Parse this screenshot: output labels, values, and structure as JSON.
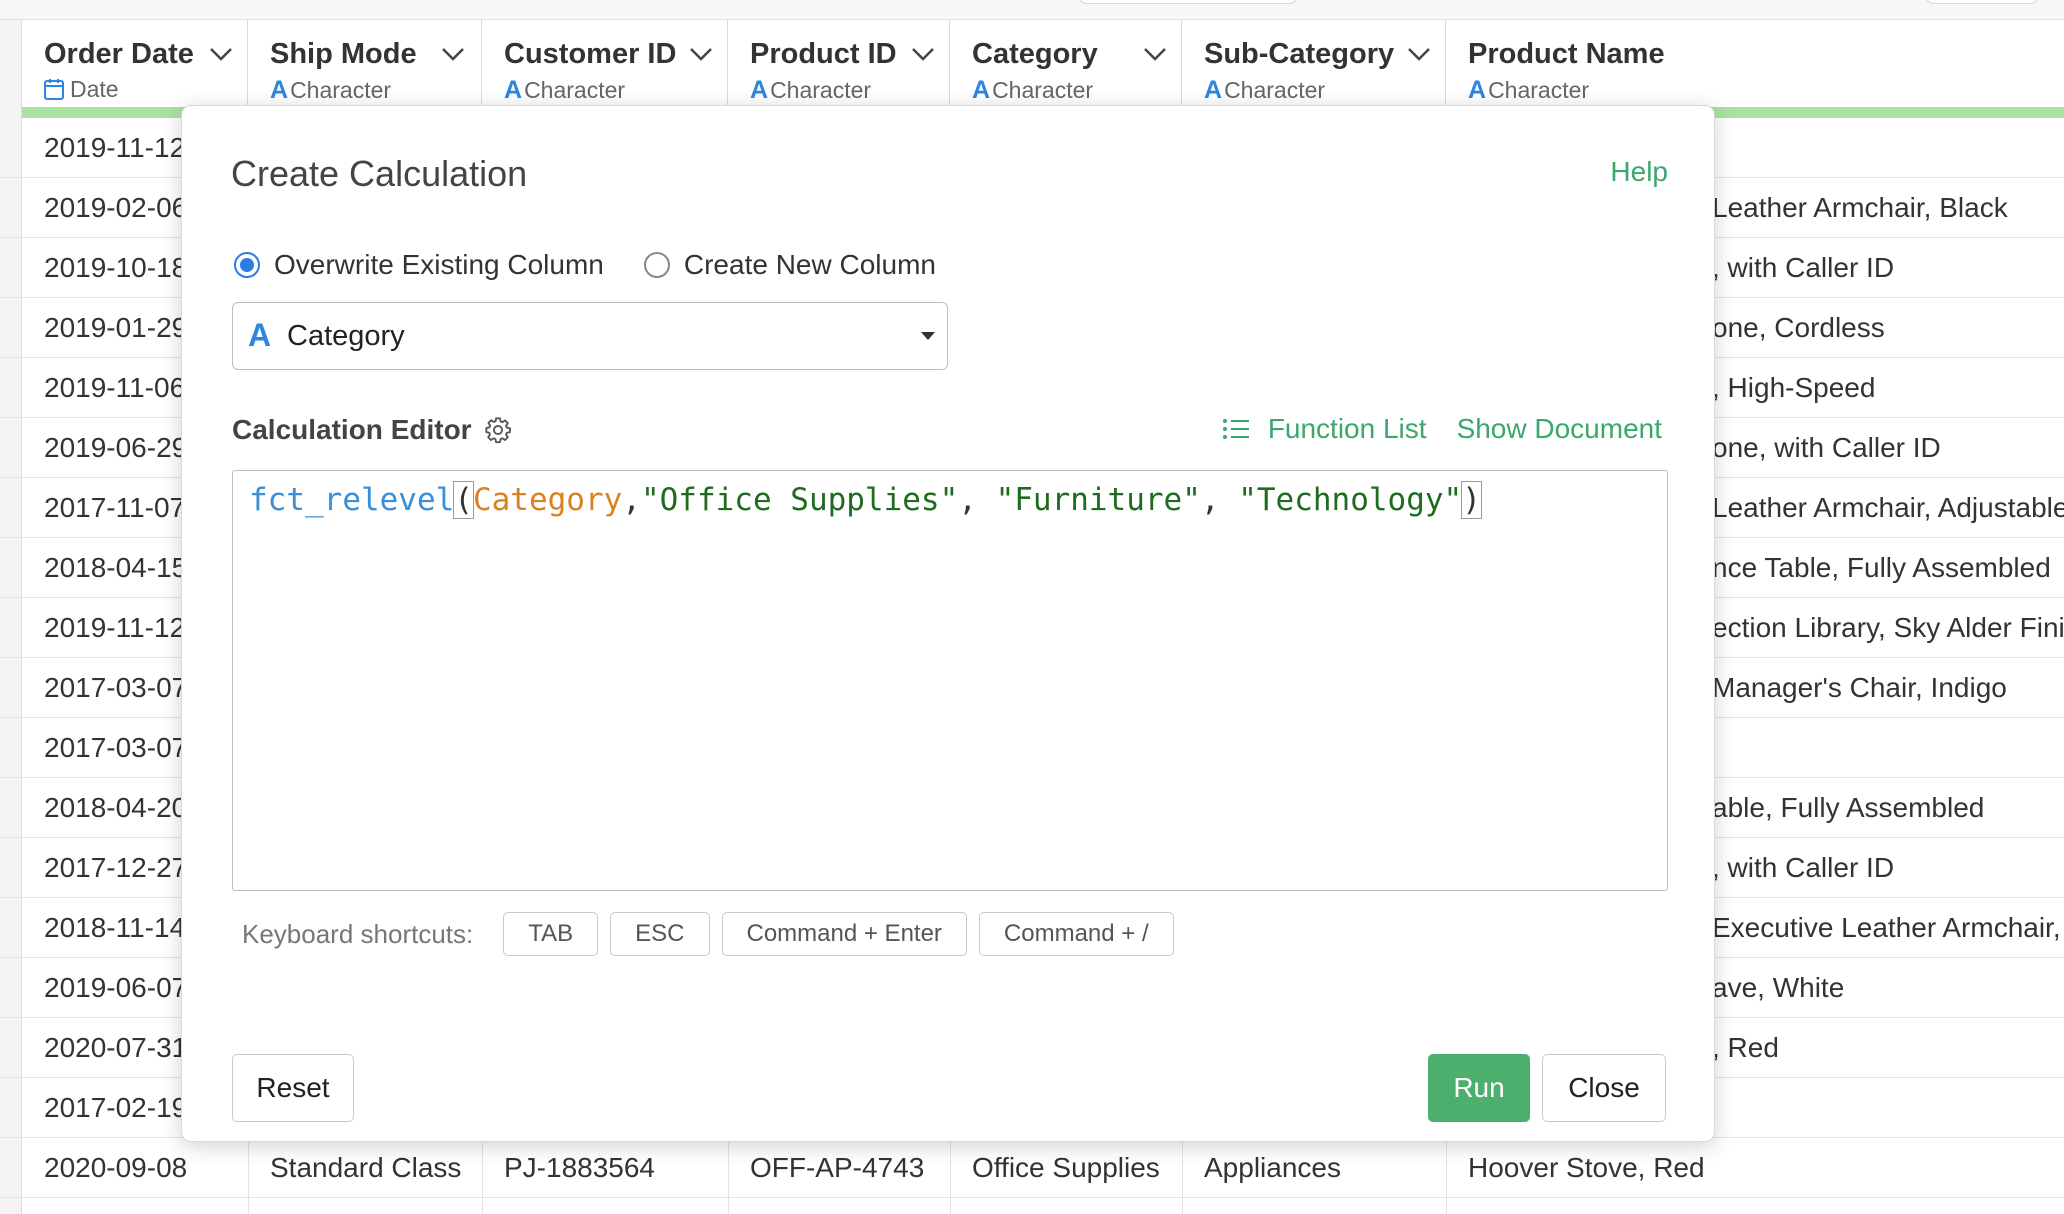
{
  "columns": [
    {
      "name": "Order Date",
      "type": "Date",
      "type_icon": "calendar-icon"
    },
    {
      "name": "Ship Mode",
      "type": "Character",
      "type_icon": "character-type-icon"
    },
    {
      "name": "Customer ID",
      "type": "Character",
      "type_icon": "character-type-icon"
    },
    {
      "name": "Product ID",
      "type": "Character",
      "type_icon": "character-type-icon"
    },
    {
      "name": "Category",
      "type": "Character",
      "type_icon": "character-type-icon"
    },
    {
      "name": "Sub-Category",
      "type": "Character",
      "type_icon": "character-type-icon"
    },
    {
      "name": "Product Name",
      "type": "Character",
      "type_icon": "character-type-icon"
    }
  ],
  "type_letter": "A",
  "rows": [
    {
      "order_date": "2019-11-12",
      "product_name": ""
    },
    {
      "order_date": "2019-02-06",
      "product_name": "Leather Armchair, Black"
    },
    {
      "order_date": "2019-10-18",
      "product_name": ", with Caller ID"
    },
    {
      "order_date": "2019-01-29",
      "product_name": "one, Cordless"
    },
    {
      "order_date": "2019-11-06",
      "product_name": ", High-Speed"
    },
    {
      "order_date": "2019-06-29",
      "product_name": "one, with Caller ID"
    },
    {
      "order_date": "2017-11-07",
      "product_name": "Leather Armchair, Adjustable"
    },
    {
      "order_date": "2018-04-15",
      "product_name": "nce Table, Fully Assembled"
    },
    {
      "order_date": "2019-11-12",
      "product_name": "ection Library, Sky Alder Finish"
    },
    {
      "order_date": "2017-03-07",
      "product_name": "Manager's Chair, Indigo"
    },
    {
      "order_date": "2017-03-07",
      "product_name": ""
    },
    {
      "order_date": "2018-04-20",
      "product_name": "able, Fully Assembled"
    },
    {
      "order_date": "2017-12-27",
      "product_name": ", with Caller ID"
    },
    {
      "order_date": "2018-11-14",
      "product_name": "Executive Leather Armchair, A"
    },
    {
      "order_date": "2019-06-07",
      "product_name": "ave, White"
    },
    {
      "order_date": "2020-07-31",
      "product_name": ", Red"
    },
    {
      "order_date": "2017-02-19",
      "product_name": ""
    }
  ],
  "last_row": {
    "order_date": "2020-09-08",
    "ship_mode": "Standard Class",
    "customer_id": "PJ-1883564",
    "product_id": "OFF-AP-4743",
    "category": "Office Supplies",
    "sub_category": "Appliances",
    "product_name": "Hoover Stove, Red"
  },
  "dialog": {
    "title": "Create Calculation",
    "help": "Help",
    "radio_overwrite": "Overwrite Existing Column",
    "radio_new": "Create New Column",
    "selected_mode": "overwrite",
    "column_select": {
      "type_letter": "A",
      "value": "Category"
    },
    "editor_label": "Calculation Editor",
    "function_list": "Function List",
    "show_document": "Show Document",
    "code": {
      "fn": "fct_relevel",
      "open": "(",
      "col": "Category",
      "comma1": ",",
      "s1": "\"Office Supplies\"",
      "sep1": ", ",
      "s2": "\"Furniture\"",
      "sep2": ", ",
      "s3": "\"Technology\"",
      "close": ")"
    },
    "shortcuts_label": "Keyboard shortcuts:",
    "shortcuts": [
      "TAB",
      "ESC",
      "Command + Enter",
      "Command + /"
    ],
    "reset": "Reset",
    "run": "Run",
    "close": "Close"
  },
  "colors": {
    "accent_green": "#3aa76d",
    "run_button": "#4caf6e",
    "type_blue": "#2e86de",
    "header_bar": "#a9e2a1",
    "code_function": "#3b8fd6",
    "code_column": "#d98221",
    "code_string": "#1f6b1f"
  }
}
